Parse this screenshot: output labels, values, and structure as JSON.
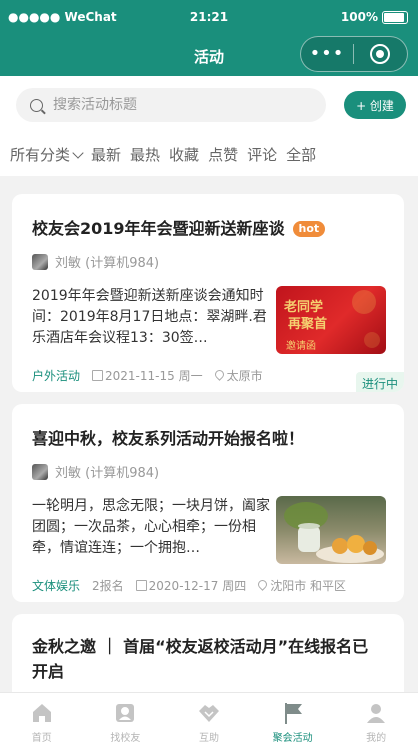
{
  "statusbar": {
    "carrier": "●●●●● WeChat",
    "time": "21:21",
    "battery": "100%"
  },
  "navbar": {
    "title": "活动",
    "more_label": "•••"
  },
  "search": {
    "placeholder": "搜索活动标题"
  },
  "create_button": {
    "label": "+ 创建"
  },
  "filters": [
    "所有分类",
    "最新",
    "最热",
    "收藏",
    "点赞",
    "评论",
    "全部"
  ],
  "activities": [
    {
      "title": "校友会2019年年会暨迎新送新座谈",
      "badge": "hot",
      "author": "刘敏 (计算机984)",
      "description": "2019年年会暨迎新送新座谈会通知时间：2019年8月17日地点：翠湖畔.君乐酒店年会议程13：30签…",
      "thumb_text": "老同学再聚首 邀请函",
      "category": "户外活动",
      "signups": "",
      "date": "2021-11-15 周一",
      "location": "太原市",
      "status": "进行中"
    },
    {
      "title": "喜迎中秋，校友系列活动开始报名啦！",
      "badge": "",
      "author": "刘敏 (计算机984)",
      "description": "一轮明月，思念无限；一块月饼，阖家团圆；一次品茶，心心相牵；一份相牵，情谊连连；一个拥抱…",
      "thumb_text": "",
      "category": "文体娱乐",
      "signups": "2报名",
      "date": "2020-12-17 周四",
      "location": "沈阳市 和平区",
      "status": ""
    },
    {
      "title": "金秋之邀 ｜ 首届“校友返校活动月”在线报名已开启"
    }
  ],
  "tabbar": [
    {
      "label": "首页",
      "icon": "home-icon"
    },
    {
      "label": "找校友",
      "icon": "find-alumni-icon"
    },
    {
      "label": "互助",
      "icon": "handshake-icon"
    },
    {
      "label": "聚会活动",
      "icon": "flag-icon",
      "active": true
    },
    {
      "label": "我的",
      "icon": "user-icon"
    }
  ],
  "colors": {
    "brand": "#1a8f7c",
    "hot": "#f08c3a"
  }
}
